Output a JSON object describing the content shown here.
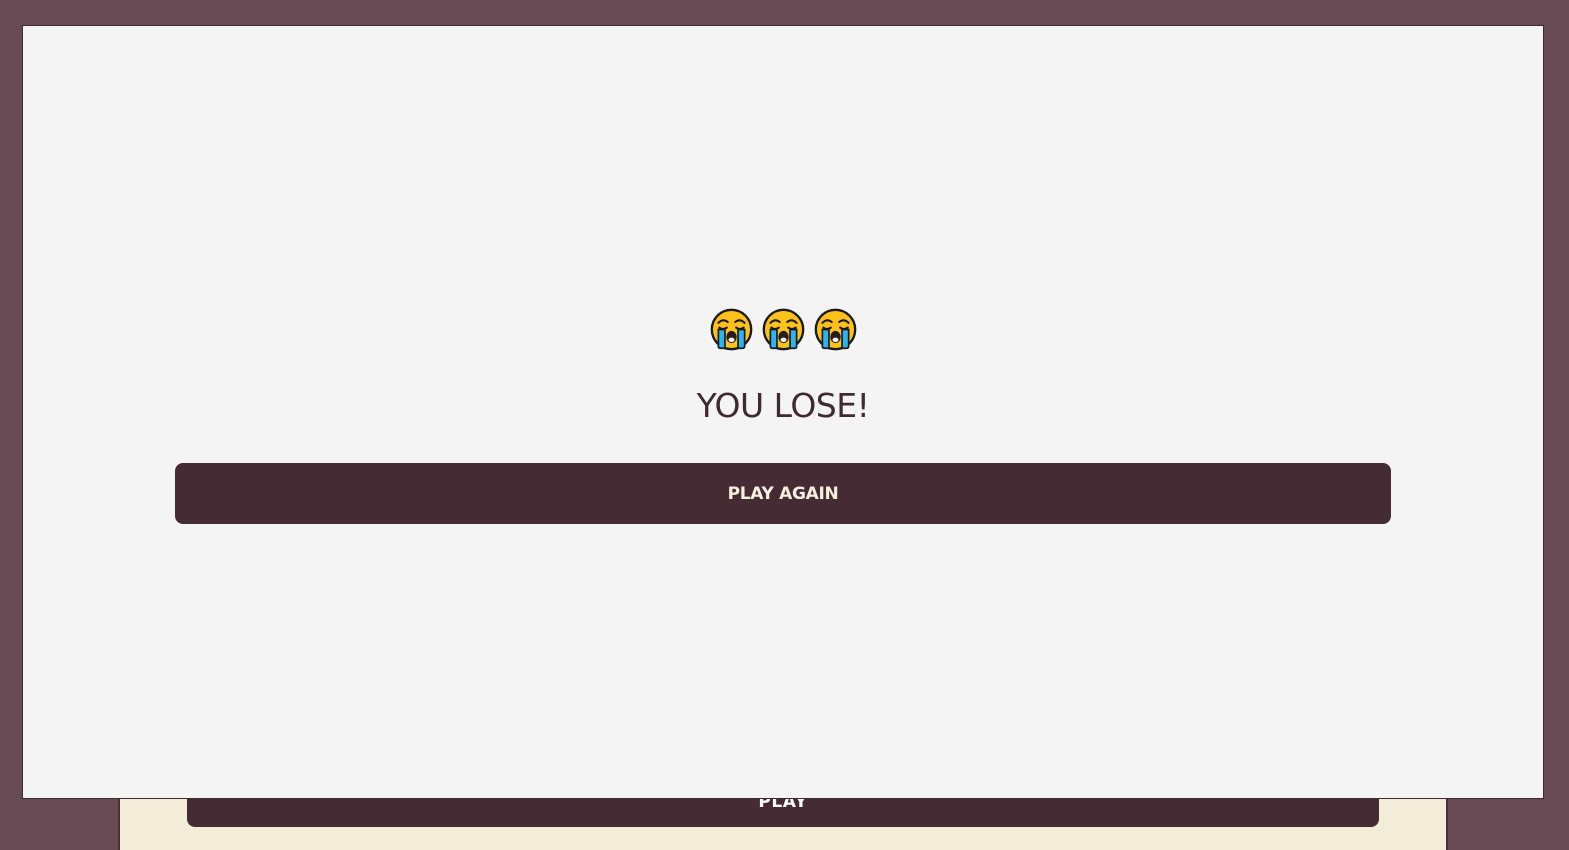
{
  "background_game": {
    "play_button_label": "PLAY"
  },
  "modal": {
    "emojis": [
      {
        "icon": "loudly-crying-face-icon"
      },
      {
        "icon": "loudly-crying-face-icon"
      },
      {
        "icon": "loudly-crying-face-icon"
      }
    ],
    "result_text": "YOU LOSE!",
    "play_again_label": "PLAY AGAIN"
  },
  "colors": {
    "frame": "#684a54",
    "modal_bg": "#f4f4f4",
    "button_bg": "#452c34",
    "button_text": "#f6efdf",
    "title_text": "#3f2a31",
    "panel_bg": "#f3ecd9"
  }
}
